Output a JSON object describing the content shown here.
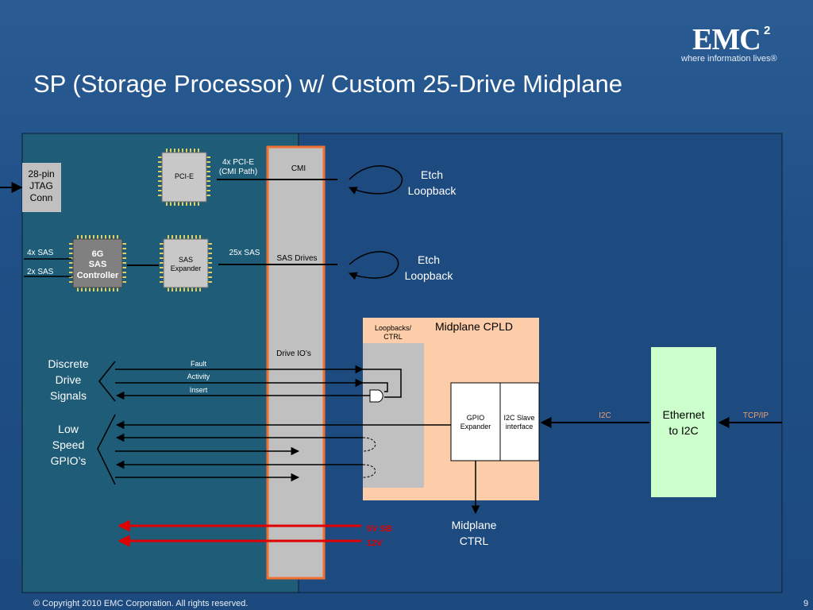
{
  "slide": {
    "title": "SP (Storage Processor) w/ Custom 25-Drive Midplane",
    "logo_mark": "EMC",
    "logo_superscript": "2",
    "logo_tagline": "where information lives®",
    "copyright": "© Copyright 2010 EMC Corporation. All rights reserved.",
    "page_number": "9"
  },
  "diagram": {
    "jtag": {
      "line1": "28-pin",
      "line2": "JTAG",
      "line3": "Conn"
    },
    "pcie_chip": "PCI-E",
    "pcie_bus": {
      "line1": "4x PCI-E",
      "line2": "(CMI Path)"
    },
    "cmi": "CMI",
    "etch_loopback_1": {
      "line1": "Etch",
      "line2": "Loopback"
    },
    "sas_controller": {
      "line1": "6G",
      "line2": "SAS",
      "line3": "Controller"
    },
    "sas_4x": "4x SAS",
    "sas_2x": "2x SAS",
    "sas_expander": {
      "line1": "SAS",
      "line2": "Expander"
    },
    "sas_25x": "25x SAS",
    "sas_drives": "SAS Drives",
    "etch_loopback_2": {
      "line1": "Etch",
      "line2": "Loopback"
    },
    "loopbacks_ctrl": {
      "line1": "Loopbacks/",
      "line2": "CTRL"
    },
    "midplane_cpld": "Midplane CPLD",
    "drive_ios": "Drive IO’s",
    "discrete": {
      "line1": "Discrete",
      "line2": "Drive",
      "line3": "Signals"
    },
    "fault": "Fault",
    "activity": "Activity",
    "insert": "Insert",
    "gpio_expander": {
      "line1": "GPIO",
      "line2": "Expander"
    },
    "i2c_slave": {
      "line1": "I2C Slave",
      "line2": "interface"
    },
    "i2c": "I2C",
    "ethernet": {
      "line1": "Ethernet",
      "line2": "to I2C"
    },
    "tcpip": "TCP/IP",
    "low_speed": {
      "line1": "Low",
      "line2": "Speed",
      "line3": "GPIO’s"
    },
    "power_5v": "5V SB",
    "power_12v": "12V",
    "midplane_ctrl": {
      "line1": "Midplane",
      "line2": "CTRL"
    }
  },
  "colors": {
    "backplane_bar": "#c0c0c0",
    "backplane_border": "#f07030",
    "cpld_fill": "#fdcca8",
    "ethernet_fill": "#ccffcc",
    "chip_fill": "#c8c8c8",
    "power_line": "#e00000"
  }
}
